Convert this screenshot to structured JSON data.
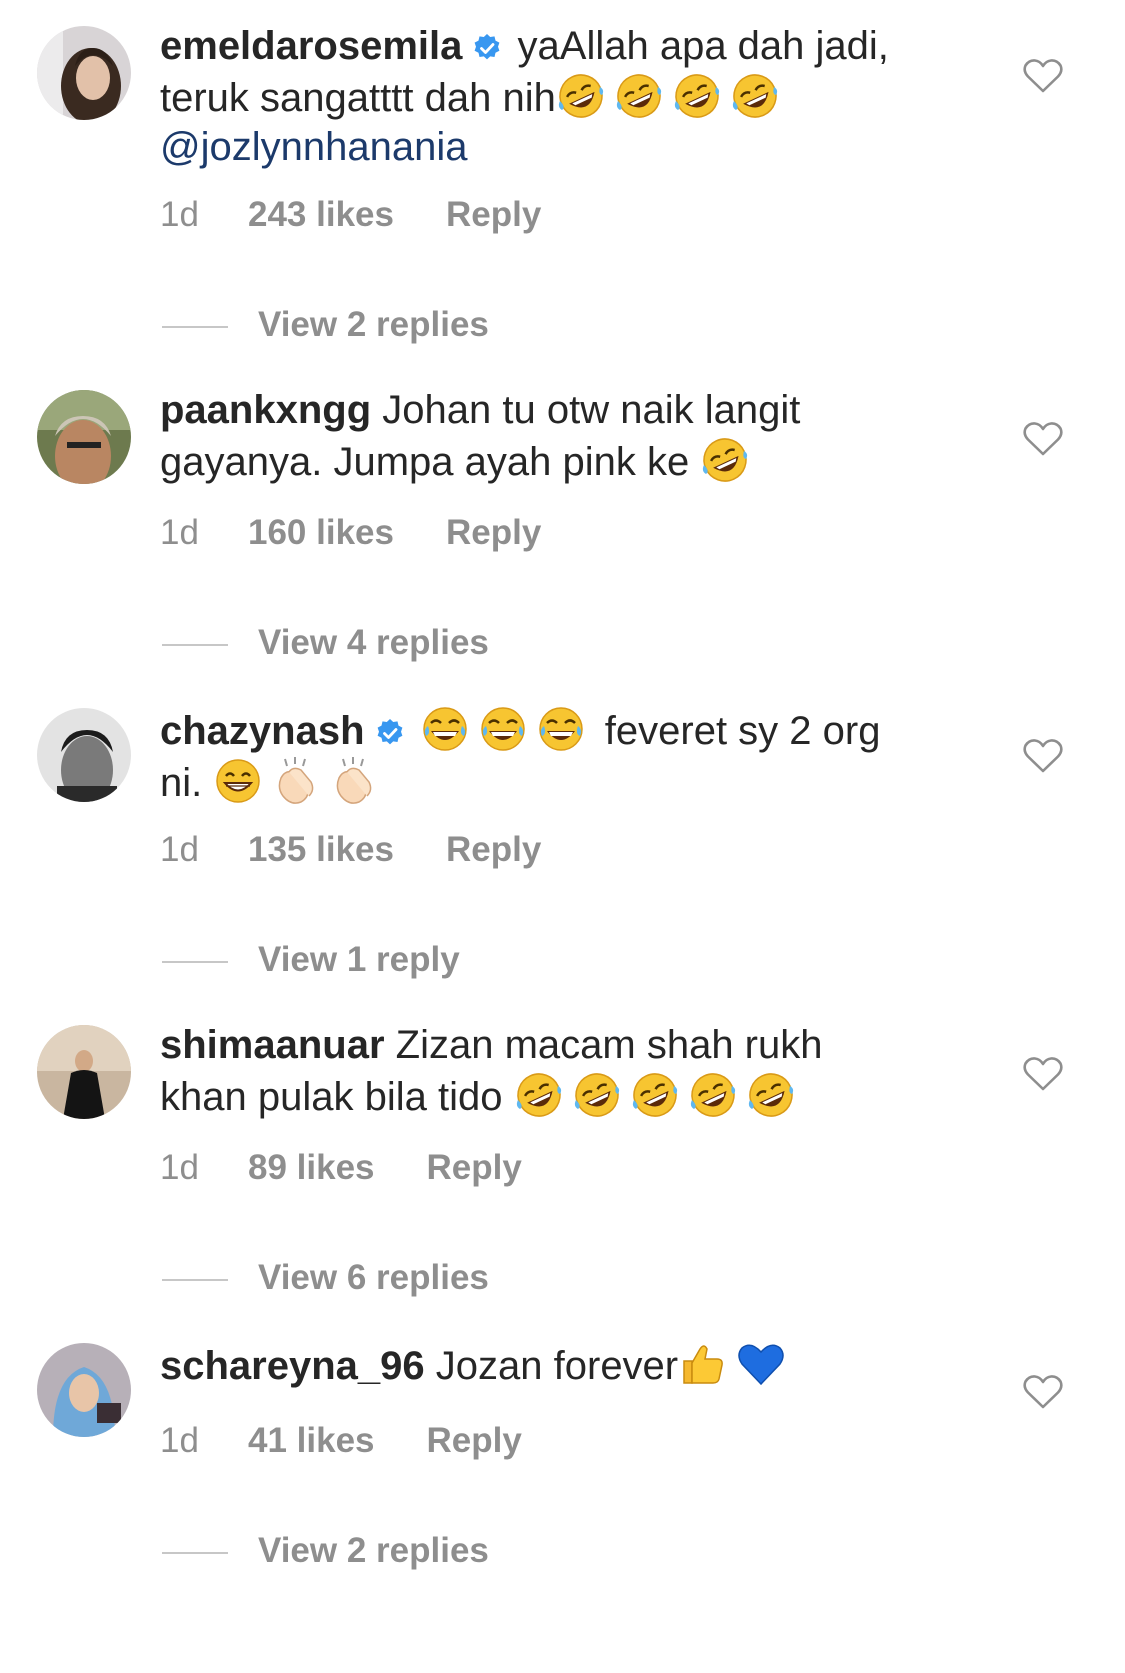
{
  "comments": [
    {
      "username": "emeldarosemila",
      "verified": true,
      "text_1": "yaAllah apa dah jadi,",
      "text_2": "teruk sangatttt dah nih",
      "emojis": "🤣🤣🤣🤣",
      "mention": "@jozlynnhanania",
      "time": "1d",
      "likes": "243 likes",
      "reply": "Reply",
      "view_replies": "View 2 replies"
    },
    {
      "username": "paankxngg",
      "verified": false,
      "text_1": "Johan tu otw naik langit",
      "text_2": "gayanya. Jumpa ayah pink ke",
      "emojis": "🤣",
      "time": "1d",
      "likes": "160 likes",
      "reply": "Reply",
      "view_replies": "View 4 replies"
    },
    {
      "username": "chazynash",
      "verified": true,
      "emojis_1": "😂😂😂",
      "text_1": "feveret sy 2 org",
      "text_2": "ni.",
      "emojis_2": "😁👏🏻👏🏻",
      "time": "1d",
      "likes": "135 likes",
      "reply": "Reply",
      "view_replies": "View 1 reply"
    },
    {
      "username": "shimaanuar",
      "verified": false,
      "text_1": "Zizan macam shah rukh",
      "text_2": "khan pulak bila tido",
      "emojis": "🤣🤣🤣🤣🤣",
      "time": "1d",
      "likes": "89 likes",
      "reply": "Reply",
      "view_replies": "View 6 replies"
    },
    {
      "username": "schareyna_96",
      "verified": false,
      "text_1": "Jozan forever",
      "emojis": "👍💙",
      "time": "1d",
      "likes": "41 likes",
      "reply": "Reply",
      "view_replies": "View 2 replies"
    }
  ],
  "colors": {
    "text": "#262626",
    "secondary": "#8e8e8e",
    "verified": "#3897f0",
    "mention": "#1c3a6b"
  }
}
